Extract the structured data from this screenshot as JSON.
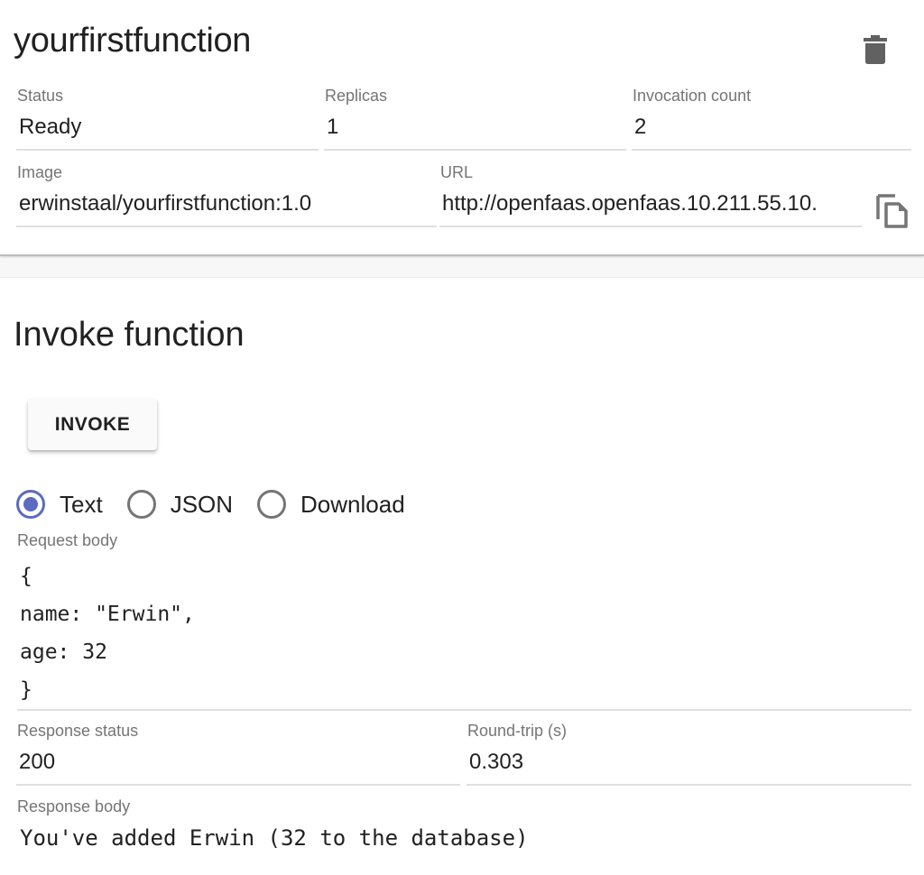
{
  "function": {
    "name": "yourfirstfunction",
    "delete_icon": "trash-icon",
    "fields": {
      "status": {
        "label": "Status",
        "value": "Ready"
      },
      "replicas": {
        "label": "Replicas",
        "value": "1"
      },
      "invocation_count": {
        "label": "Invocation count",
        "value": "2"
      },
      "image": {
        "label": "Image",
        "value": "erwinstaal/yourfirstfunction:1.0"
      },
      "url": {
        "label": "URL",
        "value": "http://openfaas.openfaas.10.211.55.10."
      }
    },
    "copy_icon": "copy-icon"
  },
  "invoke": {
    "title": "Invoke function",
    "button_label": "INVOKE",
    "response_type": {
      "options": [
        {
          "label": "Text",
          "checked": true
        },
        {
          "label": "JSON",
          "checked": false
        },
        {
          "label": "Download",
          "checked": false
        }
      ],
      "accent_color": "#5c6bc0"
    },
    "request_body": {
      "label": "Request body",
      "lines": [
        "{",
        "name: \"Erwin\",",
        "age: 32",
        "}"
      ]
    },
    "response_status": {
      "label": "Response status",
      "value": "200"
    },
    "round_trip": {
      "label": "Round-trip (s)",
      "value": "0.303"
    },
    "response_body": {
      "label": "Response body",
      "value": "You've added Erwin (32 to the database)"
    }
  }
}
